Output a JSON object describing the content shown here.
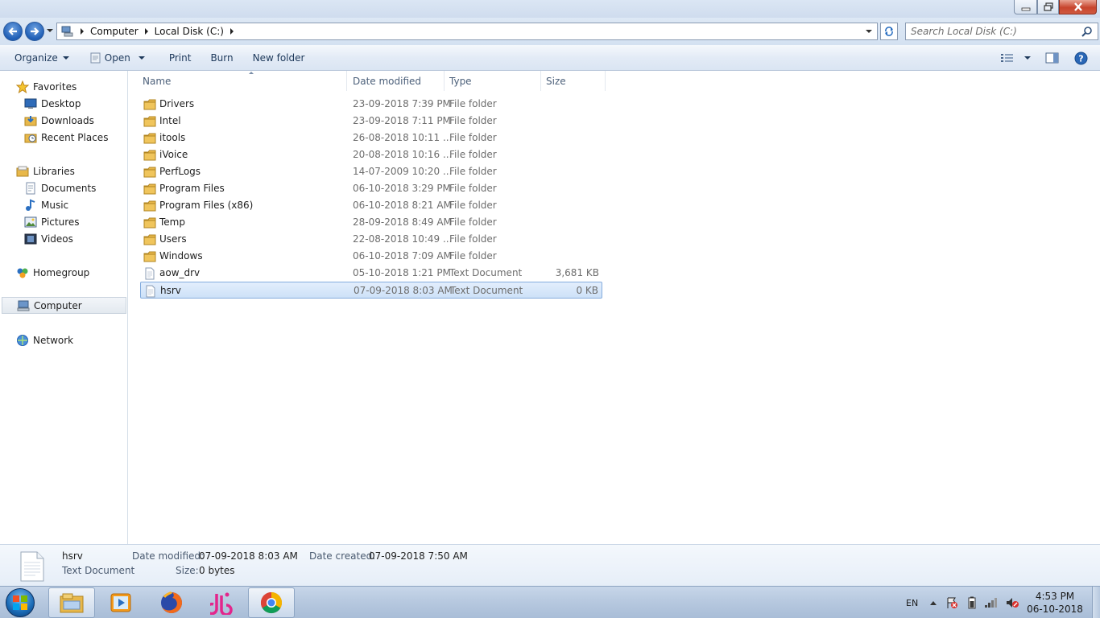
{
  "window": {
    "controls": {
      "minimize_icon": "minimize-icon",
      "maximize_icon": "restore-icon",
      "close_icon": "close-icon"
    }
  },
  "address_bar": {
    "crumbs": [
      "Computer",
      "Local Disk (C:)"
    ],
    "search_placeholder": "Search Local Disk (C:)"
  },
  "command_bar": {
    "organize": "Organize",
    "open": "Open",
    "print": "Print",
    "burn": "Burn",
    "new_folder": "New folder"
  },
  "nav": {
    "favorites": "Favorites",
    "desktop": "Desktop",
    "downloads": "Downloads",
    "recent_places": "Recent Places",
    "libraries": "Libraries",
    "documents": "Documents",
    "music": "Music",
    "pictures": "Pictures",
    "videos": "Videos",
    "homegroup": "Homegroup",
    "computer": "Computer",
    "network": "Network"
  },
  "columns": {
    "name": "Name",
    "date": "Date modified",
    "type": "Type",
    "size": "Size"
  },
  "files": [
    {
      "name": "Drivers",
      "date": "23-09-2018 7:39 PM",
      "type": "File folder",
      "size": ""
    },
    {
      "name": "Intel",
      "date": "23-09-2018 7:11 PM",
      "type": "File folder",
      "size": ""
    },
    {
      "name": "itools",
      "date": "26-08-2018 10:11 ...",
      "type": "File folder",
      "size": ""
    },
    {
      "name": "iVoice",
      "date": "20-08-2018 10:16 ...",
      "type": "File folder",
      "size": ""
    },
    {
      "name": "PerfLogs",
      "date": "14-07-2009 10:20 ...",
      "type": "File folder",
      "size": ""
    },
    {
      "name": "Program Files",
      "date": "06-10-2018 3:29 PM",
      "type": "File folder",
      "size": ""
    },
    {
      "name": "Program Files (x86)",
      "date": "06-10-2018 8:21 AM",
      "type": "File folder",
      "size": ""
    },
    {
      "name": "Temp",
      "date": "28-09-2018 8:49 AM",
      "type": "File folder",
      "size": ""
    },
    {
      "name": "Users",
      "date": "22-08-2018 10:49 ...",
      "type": "File folder",
      "size": ""
    },
    {
      "name": "Windows",
      "date": "06-10-2018 7:09 AM",
      "type": "File folder",
      "size": ""
    },
    {
      "name": "aow_drv",
      "date": "05-10-2018 1:21 PM",
      "type": "Text Document",
      "size": "3,681 KB"
    },
    {
      "name": "hsrv",
      "date": "07-09-2018 8:03 AM",
      "type": "Text Document",
      "size": "0 KB"
    }
  ],
  "details": {
    "name": "hsrv",
    "type": "Text Document",
    "modified_label": "Date modified:",
    "modified_value": "07-09-2018 8:03 AM",
    "created_label": "Date created:",
    "created_value": "07-09-2018 7:50 AM",
    "size_label": "Size:",
    "size_value": "0 bytes"
  },
  "taskbar": {
    "apps": [
      "explorer-icon",
      "media-player-icon",
      "firefox-icon",
      "ivoice-app-icon",
      "chrome-icon"
    ],
    "lang": "EN",
    "time": "4:53 PM",
    "date": "06-10-2018"
  },
  "colors": {
    "selection": "#cde1f8",
    "selection_border": "#84acdd",
    "folder": "#e8b84a",
    "link_text": "#1e395b"
  }
}
